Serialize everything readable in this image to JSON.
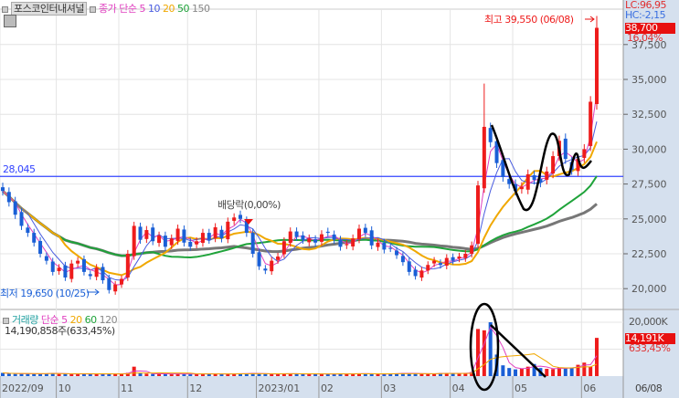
{
  "header": {
    "stock_name": "포스코인터내셔널",
    "ma_title": "종가 단순",
    "ma_periods": [
      "5",
      "10",
      "20",
      "50",
      "150"
    ]
  },
  "volume_header": {
    "title": "거래량",
    "ma_title": "단순",
    "ma_periods": [
      "5",
      "20",
      "60",
      "120"
    ],
    "current": "14,190,858주(633,45%)"
  },
  "right_axis": {
    "lc": "LC:96,95",
    "hc": "HC:-2,15",
    "last_price": "38,700",
    "last_change": "16,04%",
    "price_ticks": [
      "37,500",
      "35,000",
      "32,500",
      "30,000",
      "27,500",
      "25,000",
      "22,500",
      "20,000"
    ],
    "volume_tick": "20,000K",
    "last_volume": "14,191K",
    "volume_pct": "633,45%",
    "date": "06/08"
  },
  "annotations": {
    "high": "최고 39,550 (06/08)",
    "low": "최저 19,650 (10/25)",
    "dividend": "배당락(0,00%)",
    "hline_label": "28,045"
  },
  "x_axis": {
    "labels": [
      "2022/09",
      "10",
      "11",
      "12",
      "2023/01",
      "02",
      "03",
      "04",
      "05",
      "06"
    ]
  },
  "colors": {
    "up": "#ee1c1c",
    "down": "#1a5fd6",
    "ma5": "#e040c0",
    "ma10": "#4a5de0",
    "ma20": "#f0a800",
    "ma50": "#1fa33a",
    "ma150": "#777777",
    "hline": "#3344ff"
  },
  "chart_data": {
    "type": "candlestick",
    "title": "포스코인터내셔널",
    "price_ylim": [
      19000,
      40500
    ],
    "hline": 28045,
    "price_ticks": [
      37500,
      35000,
      32500,
      30000,
      27500,
      25000,
      22500,
      20000
    ],
    "closes": [
      27000,
      26200,
      25300,
      24500,
      24000,
      23300,
      22500,
      22000,
      21200,
      21500,
      20800,
      21800,
      22000,
      21200,
      20900,
      21500,
      20600,
      19900,
      20300,
      20700,
      22500,
      24500,
      23500,
      24200,
      23400,
      23800,
      23000,
      23600,
      24300,
      23300,
      23000,
      23400,
      24000,
      23500,
      24400,
      23600,
      24800,
      25100,
      25000,
      24000,
      22500,
      21600,
      21300,
      22000,
      22300,
      23400,
      24100,
      23700,
      23500,
      23600,
      23300,
      23900,
      24000,
      23500,
      23000,
      23200,
      23600,
      24300,
      24000,
      23100,
      23300,
      22800,
      22900,
      22400,
      21900,
      21200,
      20900,
      21300,
      21700,
      22000,
      21700,
      22200,
      22000,
      22300,
      22500,
      23100,
      27400,
      31600,
      30500,
      29000,
      28000,
      27500,
      27000,
      27300,
      28200,
      27800,
      27600,
      28400,
      29500,
      30600,
      29300,
      28500,
      29300,
      30000,
      33400,
      38700
    ],
    "volumes_k": [
      1200,
      900,
      800,
      1000,
      900,
      800,
      900,
      1000,
      1100,
      800,
      900,
      700,
      800,
      900,
      800,
      700,
      800,
      900,
      800,
      900,
      1200,
      3500,
      1000,
      900,
      800,
      900,
      800,
      700,
      900,
      800,
      700,
      800,
      900,
      800,
      900,
      700,
      800,
      900,
      1000,
      900,
      1100,
      900,
      800,
      700,
      800,
      1000,
      900,
      800,
      700,
      800,
      900,
      800,
      700,
      800,
      900,
      800,
      900,
      1000,
      900,
      800,
      700,
      800,
      900,
      1000,
      1100,
      900,
      1000,
      900,
      800,
      900,
      1100,
      1000,
      900,
      1000,
      1200,
      1500,
      17500,
      17000,
      20000,
      8000,
      4000,
      3000,
      2500,
      2800,
      3500,
      4500,
      3000,
      2700,
      2600,
      3200,
      2800,
      3000,
      4200,
      5000,
      3500,
      14191
    ],
    "volume_ylim": [
      0,
      20000
    ],
    "month_start_index": [
      0,
      9,
      19,
      30,
      41,
      51,
      61,
      72,
      82,
      93
    ],
    "high": {
      "value": 39550,
      "date": "06/08"
    },
    "low": {
      "value": 19650,
      "date": "10/25"
    }
  }
}
